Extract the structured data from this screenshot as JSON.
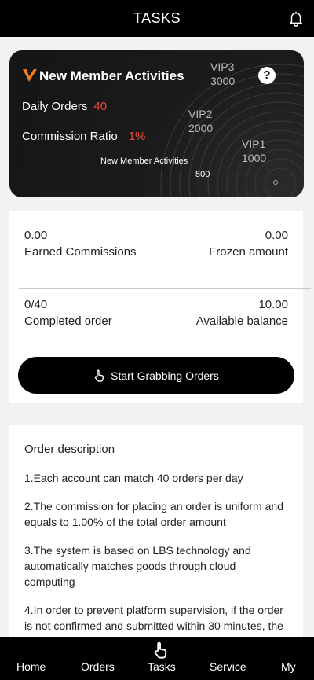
{
  "header": {
    "title": "TASKS"
  },
  "vip_card": {
    "title": "New Member Activities",
    "daily_orders_label": "Daily Orders",
    "daily_orders_value": "40",
    "commission_label": "Commission Ratio",
    "commission_value": "1%",
    "help": "?",
    "levels": [
      {
        "name": "VIP3",
        "amount": "3000"
      },
      {
        "name": "VIP2",
        "amount": "2000"
      },
      {
        "name": "VIP1",
        "amount": "1000"
      }
    ],
    "current_level_name": "New Member Activities",
    "current_level_amount": "500",
    "accent_color": "#e84a3c",
    "logo_color": "#f07a1e"
  },
  "stats": {
    "earned_value": "0.00",
    "earned_label": "Earned Commissions",
    "frozen_value": "0.00",
    "frozen_label": "Frozen amount",
    "completed_value": "0/40",
    "completed_label": "Completed order",
    "balance_value": "10.00",
    "balance_label": "Available balance"
  },
  "start_button": {
    "label": "Start Grabbing Orders",
    "icon": "hand-pointer-icon"
  },
  "description": {
    "title": "Order description",
    "items": [
      "1.Each account can match 40 orders per day",
      "2.The commission for placing an order is uniform and equals to 1.00% of the total order amount",
      "3.The system is based on LBS technology and automatically matches goods through cloud computing",
      "4.In order to prevent platform supervision, if the order is not confirmed and submitted within 30 minutes, the"
    ]
  },
  "tabbar": {
    "items": [
      {
        "label": "Home"
      },
      {
        "label": "Orders"
      },
      {
        "label": "Tasks",
        "icon": "hand-pointer-icon"
      },
      {
        "label": "Service"
      },
      {
        "label": "My"
      }
    ]
  }
}
